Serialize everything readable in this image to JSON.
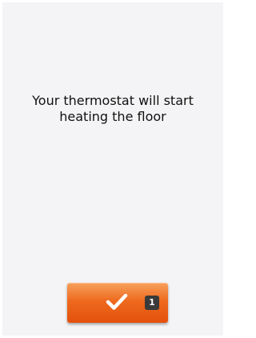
{
  "message": {
    "line1": "Your thermostat will start",
    "line2": "heating the floor"
  },
  "confirm_button": {
    "icon": "check-icon",
    "badge": "1"
  },
  "colors": {
    "background": "#f4f4f6",
    "button_accent": "#ee6a1e",
    "badge": "#3a3a3a"
  }
}
